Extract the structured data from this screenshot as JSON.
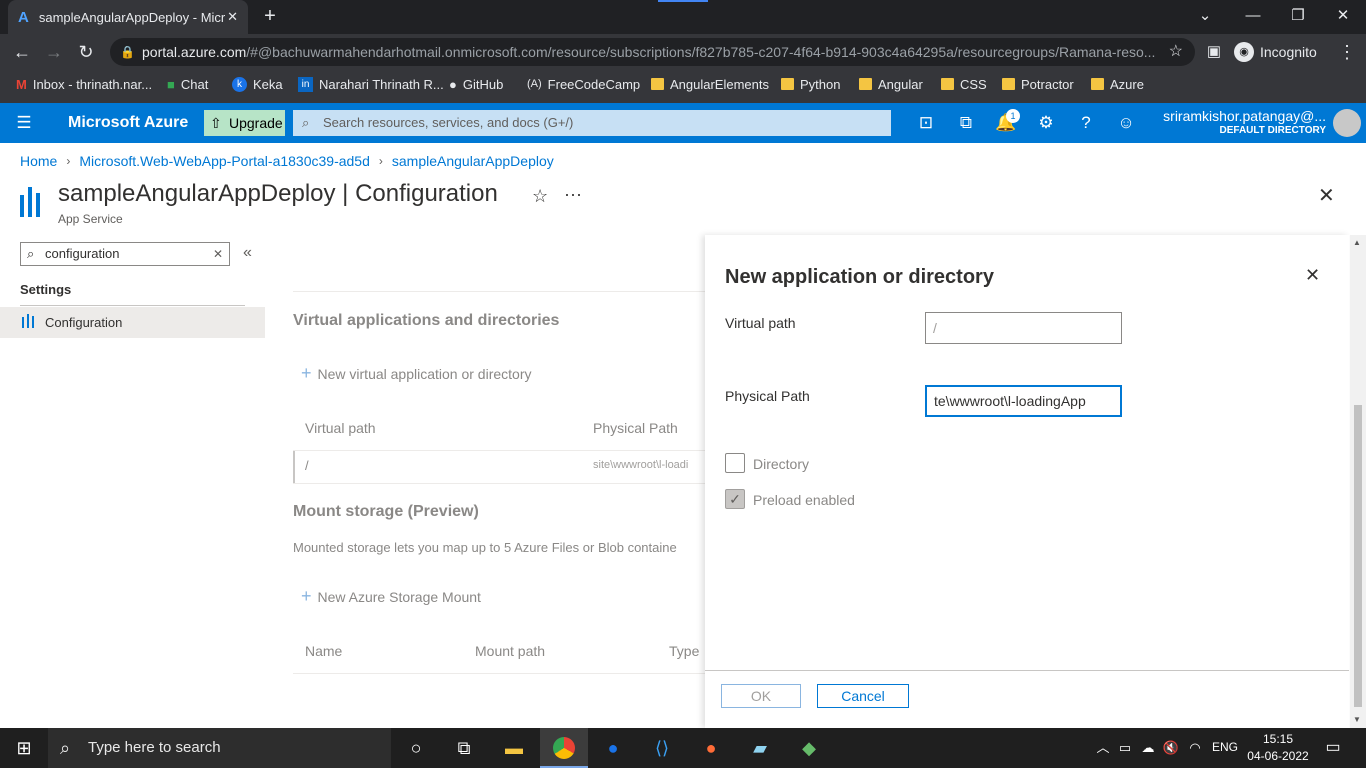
{
  "browser": {
    "tab_title": "sampleAngularAppDeploy - Micr",
    "address": "portal.azure.com",
    "address_path": "/#@bachuwarmahendarhotmail.onmicrosoft.com/resource/subscriptions/f827b785-c207-4f64-b914-903c4a64295a/resourcegroups/Ramana-reso...",
    "incognito_label": "Incognito",
    "bookmarks": [
      "Inbox - thrinath.nar...",
      "Chat",
      "Keka",
      "Narahari Thrinath R...",
      "GitHub",
      "FreeCodeCamp",
      "AngularElements",
      "Python",
      "Angular",
      "CSS",
      "Potractor",
      "Azure"
    ]
  },
  "azure": {
    "brand": "Microsoft Azure",
    "upgrade": "Upgrade",
    "search_placeholder": "Search resources, services, and docs (G+/)",
    "notif_count": "1",
    "user_name": "sriramkishor.patangay@...",
    "user_dir": "DEFAULT DIRECTORY"
  },
  "breadcrumb": [
    "Home",
    "Microsoft.Web-WebApp-Portal-a1830c39-ad5d",
    "sampleAngularAppDeploy"
  ],
  "page": {
    "title": "sampleAngularAppDeploy | Configuration",
    "subtitle": "App Service"
  },
  "sidebar": {
    "search_value": "configuration",
    "section": "Settings",
    "item": "Configuration"
  },
  "main": {
    "vad_heading": "Virtual applications and directories",
    "new_vad": "New virtual application or directory",
    "col_vpath": "Virtual path",
    "col_ppath": "Physical Path",
    "row_vpath": "/",
    "row_ppath": "site\\wwwroot\\l-loadi",
    "mount_heading": "Mount storage (Preview)",
    "mount_desc": "Mounted storage lets you map up to 5 Azure Files or Blob containe",
    "new_mount": "New Azure Storage Mount",
    "col_name": "Name",
    "col_mount": "Mount path",
    "col_type": "Type"
  },
  "panel": {
    "title": "New application or directory",
    "vpath_label": "Virtual path",
    "vpath_placeholder": "/",
    "ppath_label": "Physical Path",
    "ppath_value": "te\\wwwroot\\l-loadingApp",
    "directory_label": "Directory",
    "preload_label": "Preload enabled",
    "ok": "OK",
    "cancel": "Cancel"
  },
  "taskbar": {
    "search": "Type here to search",
    "lang": "ENG",
    "time": "15:15",
    "date": "04-06-2022"
  }
}
